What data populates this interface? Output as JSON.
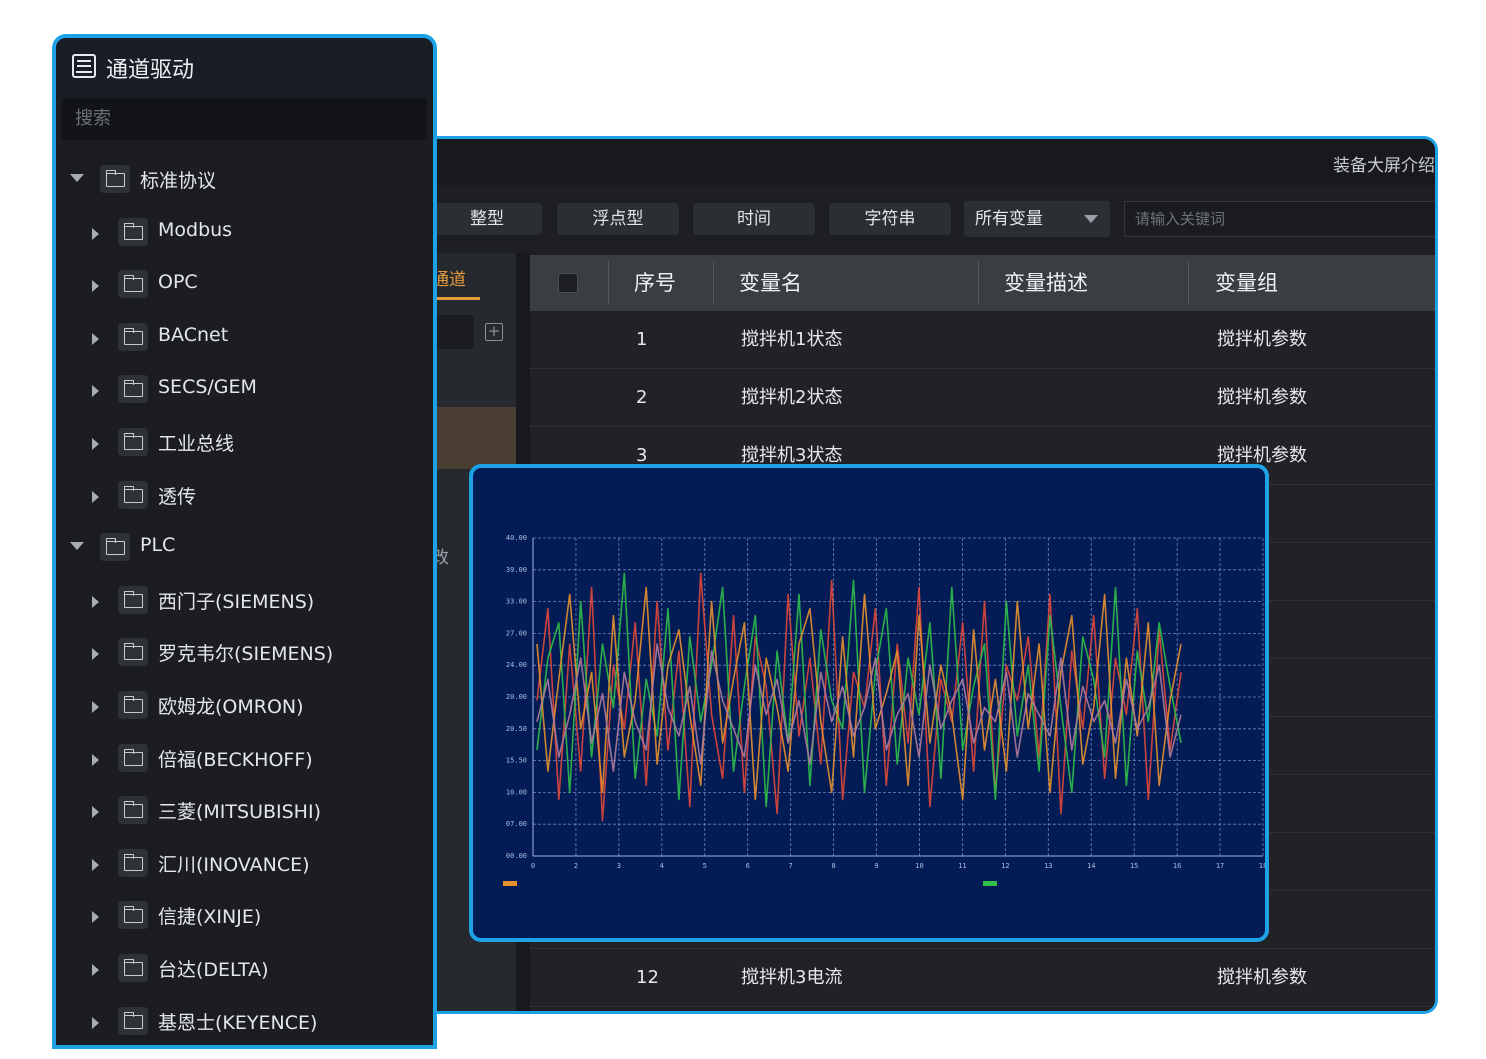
{
  "sidebar": {
    "title": "通道驱动",
    "search_placeholder": "搜索",
    "tree": [
      {
        "label": "标准协议",
        "level": 0,
        "expanded": true
      },
      {
        "label": "Modbus",
        "level": 1,
        "expanded": false
      },
      {
        "label": "OPC",
        "level": 1,
        "expanded": false
      },
      {
        "label": "BACnet",
        "level": 1,
        "expanded": false
      },
      {
        "label": "SECS/GEM",
        "level": 1,
        "expanded": false
      },
      {
        "label": "工业总线",
        "level": 1,
        "expanded": false
      },
      {
        "label": "透传",
        "level": 1,
        "expanded": false
      },
      {
        "label": "PLC",
        "level": 0,
        "expanded": true
      },
      {
        "label": "西门子(SIEMENS)",
        "level": 1,
        "expanded": false
      },
      {
        "label": "罗克韦尔(SIEMENS)",
        "level": 1,
        "expanded": false
      },
      {
        "label": "欧姆龙(OMRON)",
        "level": 1,
        "expanded": false
      },
      {
        "label": "倍福(BECKHOFF)",
        "level": 1,
        "expanded": false
      },
      {
        "label": "三菱(MITSUBISHI)",
        "level": 1,
        "expanded": false
      },
      {
        "label": "汇川(INOVANCE)",
        "level": 1,
        "expanded": false
      },
      {
        "label": "信捷(XINJE)",
        "level": 1,
        "expanded": false
      },
      {
        "label": "台达(DELTA)",
        "level": 1,
        "expanded": false
      },
      {
        "label": "基恩士(KEYENCE)",
        "level": 1,
        "expanded": false
      }
    ]
  },
  "main": {
    "title": "装备大屏介绍",
    "type_filters": [
      "整型",
      "浮点型",
      "时间",
      "字符串"
    ],
    "variable_select": "所有变量",
    "keyword_placeholder": "请输入关键词",
    "channel_tab": "通道",
    "channel_fragment": "改",
    "table": {
      "headers": [
        "序号",
        "变量名",
        "变量描述",
        "变量组"
      ],
      "rows": [
        {
          "no": "1",
          "name": "搅拌机1状态",
          "desc": "",
          "group": "搅拌机参数"
        },
        {
          "no": "2",
          "name": "搅拌机2状态",
          "desc": "",
          "group": "搅拌机参数"
        },
        {
          "no": "3",
          "name": "搅拌机3状态",
          "desc": "",
          "group": "搅拌机参数"
        },
        {
          "no": "",
          "name": "",
          "desc": "",
          "group": "参数"
        },
        {
          "no": "",
          "name": "",
          "desc": "",
          "group": "参数"
        },
        {
          "no": "",
          "name": "",
          "desc": "",
          "group": "参数"
        },
        {
          "no": "",
          "name": "",
          "desc": "",
          "group": "参数"
        },
        {
          "no": "",
          "name": "",
          "desc": "",
          "group": "参数"
        },
        {
          "no": "",
          "name": "",
          "desc": "",
          "group": "参数"
        },
        {
          "no": "",
          "name": "",
          "desc": "",
          "group": "参数"
        },
        {
          "no": "",
          "name": "",
          "desc": "",
          "group": "参数"
        },
        {
          "no": "12",
          "name": "搅拌机3电流",
          "desc": "",
          "group": "搅拌机参数"
        }
      ]
    }
  },
  "chart_data": {
    "type": "line",
    "title": "",
    "ylabel": "",
    "xlabel": "",
    "ylim": [
      0,
      45
    ],
    "y_ticks": [
      "00.00",
      "07.00",
      "10.00",
      "15.50",
      "20.50",
      "20.00",
      "24.00",
      "27.00",
      "33.00",
      "39.00",
      "40.00"
    ],
    "x_ticks": [
      "0",
      "2",
      "3",
      "4",
      "5",
      "6",
      "7",
      "8",
      "9",
      "10",
      "11",
      "12",
      "13",
      "14",
      "15",
      "16",
      "17",
      "18"
    ],
    "grid": true,
    "series": [
      {
        "color": "#e0483a",
        "values": [
          22,
          35,
          8,
          30,
          12,
          38,
          5,
          27,
          18,
          33,
          10,
          36,
          15,
          29,
          7,
          40,
          20,
          11,
          34,
          9,
          31,
          24,
          6,
          37,
          17,
          28,
          13,
          39,
          8,
          26,
          21,
          35,
          10,
          30,
          16,
          38,
          7,
          25,
          19,
          33,
          12,
          36,
          9,
          27,
          22,
          31,
          14,
          37,
          6,
          29,
          18,
          34,
          11,
          28,
          20,
          35,
          8,
          32,
          15,
          26
        ]
      },
      {
        "color": "#2fbf4a",
        "values": [
          15,
          28,
          33,
          9,
          36,
          14,
          30,
          21,
          40,
          11,
          25,
          17,
          35,
          8,
          31,
          19,
          27,
          38,
          12,
          24,
          34,
          7,
          29,
          16,
          37,
          10,
          32,
          22,
          18,
          39,
          9,
          26,
          35,
          13,
          28,
          20,
          33,
          11,
          38,
          15,
          24,
          30,
          8,
          36,
          17,
          27,
          12,
          34,
          21,
          9,
          31,
          25,
          14,
          38,
          10,
          29,
          19,
          33,
          24,
          16
        ]
      },
      {
        "color": "#e8912f",
        "values": [
          30,
          12,
          25,
          37,
          18,
          26,
          9,
          34,
          14,
          22,
          38,
          13,
          27,
          32,
          20,
          10,
          36,
          16,
          25,
          33,
          8,
          28,
          21,
          12,
          30,
          35,
          19,
          9,
          31,
          14,
          37,
          18,
          23,
          29,
          10,
          34,
          16,
          27,
          20,
          8,
          32,
          15,
          25,
          12,
          36,
          18,
          30,
          9,
          26,
          34,
          13,
          21,
          37,
          11,
          28,
          17,
          33,
          10,
          22,
          30
        ]
      },
      {
        "color": "#b07c9c",
        "values": [
          19,
          25,
          14,
          20,
          28,
          16,
          23,
          12,
          26,
          19,
          15,
          30,
          21,
          17,
          24,
          13,
          29,
          22,
          18,
          14,
          27,
          20,
          25,
          16,
          22,
          13,
          26,
          19,
          24,
          17,
          21,
          28,
          15,
          20,
          23,
          14,
          27,
          18,
          22,
          25,
          16,
          21,
          19,
          26,
          14,
          23,
          20,
          17,
          28,
          15,
          24,
          19,
          22,
          16,
          25,
          18,
          21,
          27,
          14,
          20
        ]
      }
    ],
    "legend": [
      "",
      ""
    ]
  }
}
